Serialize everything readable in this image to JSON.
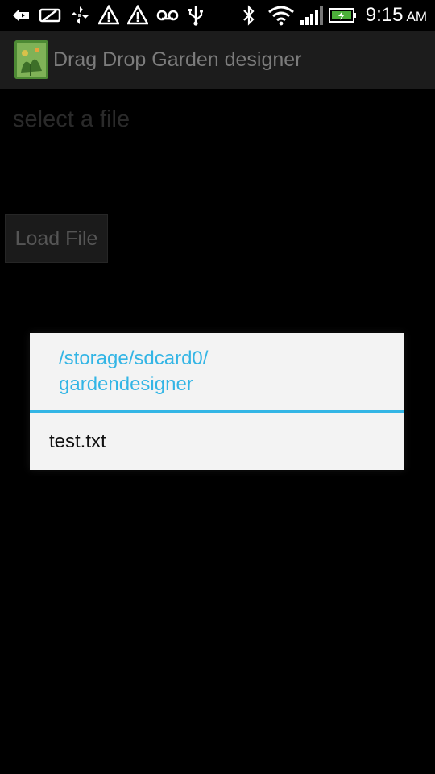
{
  "status_bar": {
    "icons": [
      "back-arrow-icon",
      "phone-icon",
      "pinwheel-icon",
      "warning-icon",
      "warning-icon",
      "voicemail-icon",
      "usb-icon",
      "bluetooth-icon",
      "wifi-icon",
      "signal-icon",
      "battery-charging-icon"
    ],
    "time": "9:15",
    "ampm": "AM"
  },
  "action_bar": {
    "title": "Drag Drop Garden designer",
    "icon": "app-icon"
  },
  "content": {
    "prompt": "select a file",
    "load_button_label": "Load File"
  },
  "dialog": {
    "title_line1": "/storage/sdcard0/",
    "title_line2": "gardendesigner",
    "items": [
      {
        "label": "test.txt"
      }
    ]
  },
  "colors": {
    "accent": "#33b5e5",
    "background": "#000000",
    "dialog_bg": "#f3f3f3"
  }
}
